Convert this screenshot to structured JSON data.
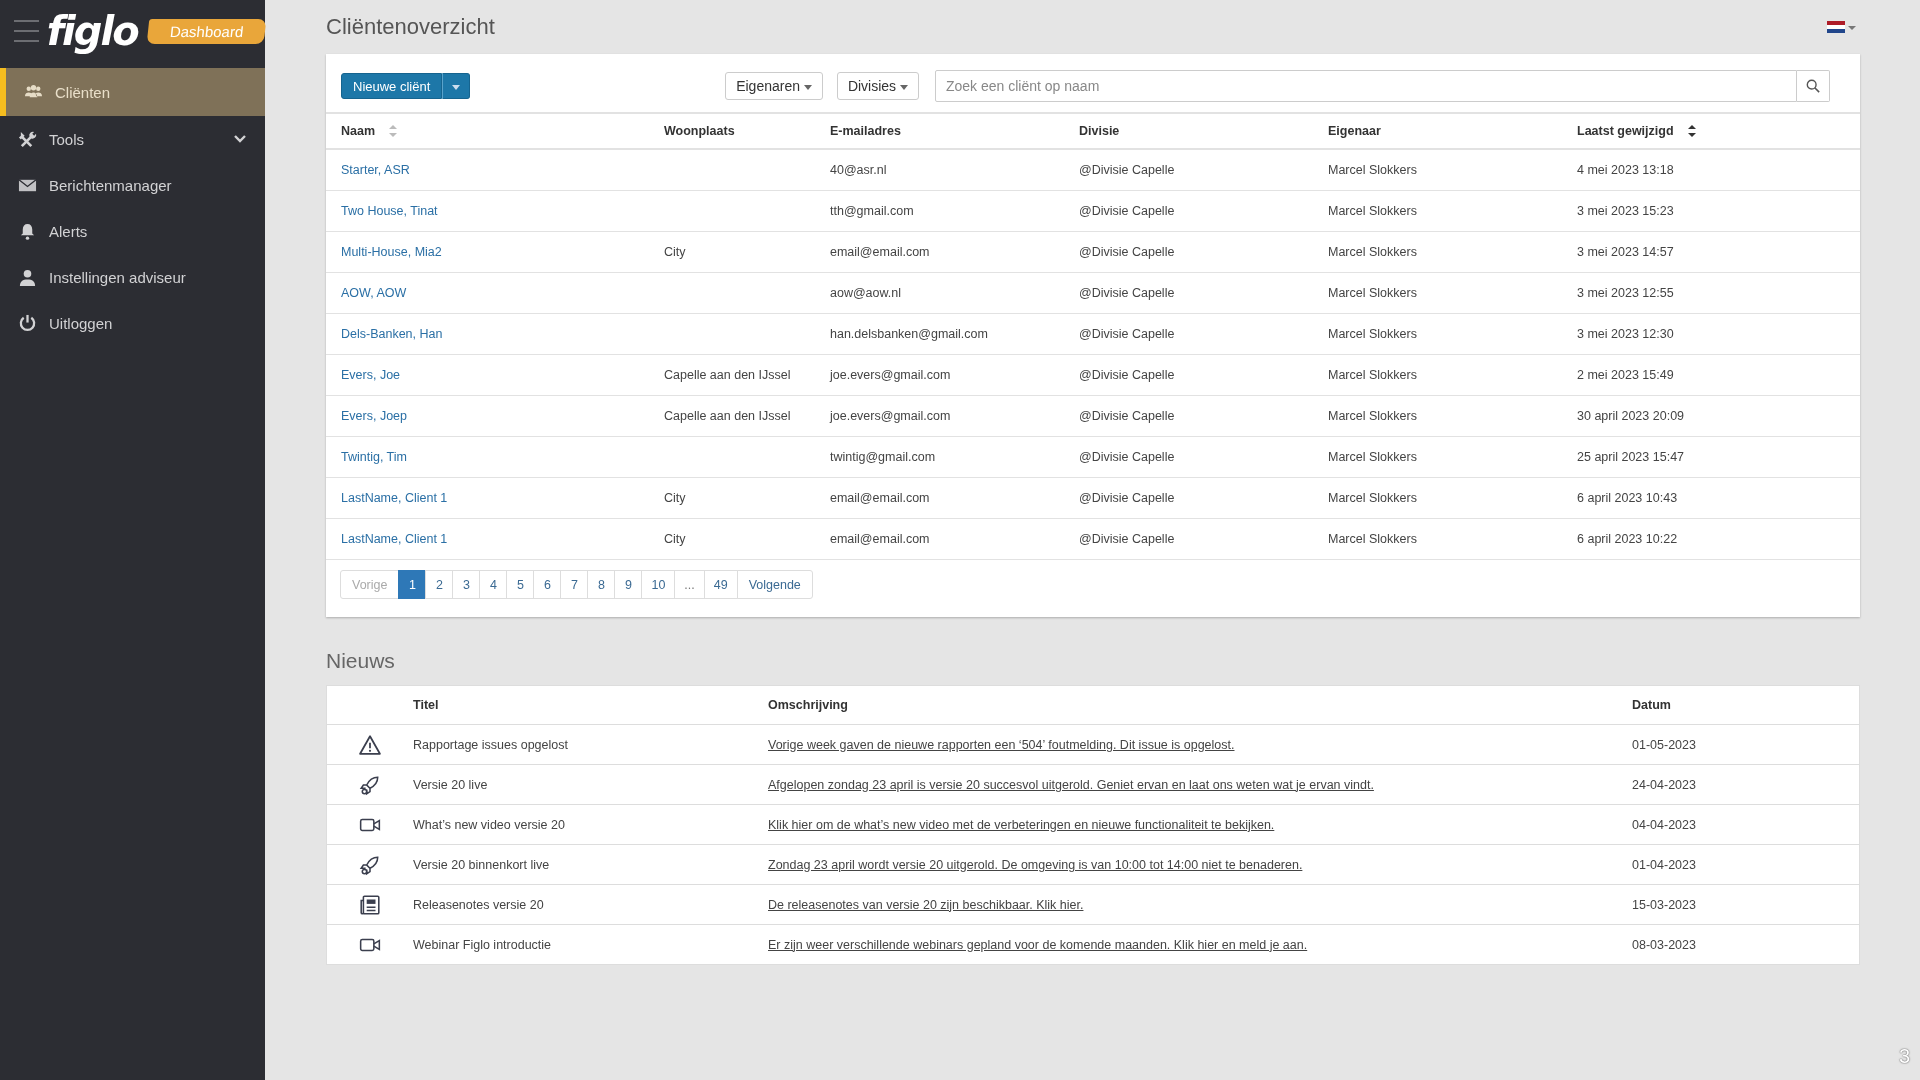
{
  "sidebar": {
    "logo": "figlo",
    "badge": "Dashboard",
    "items": [
      {
        "label": "Cliënten",
        "kind": "users",
        "selected": true
      },
      {
        "label": "Tools",
        "kind": "tools",
        "selected": false,
        "expandable": true
      },
      {
        "label": "Berichtenmanager",
        "kind": "mail",
        "selected": false
      },
      {
        "label": "Alerts",
        "kind": "bell",
        "selected": false
      },
      {
        "label": "Instellingen adviseur",
        "kind": "user",
        "selected": false
      },
      {
        "label": "Uitloggen",
        "kind": "power",
        "selected": false
      }
    ]
  },
  "page_title": "Cliëntenoverzicht",
  "toolbar": {
    "new_button": "Nieuwe cliënt",
    "filters": [
      "Eigenaren",
      "Divisies"
    ],
    "search": {
      "placeholder": "Zoek een cliënt op naam"
    }
  },
  "clients": {
    "columns": [
      {
        "label": "Naam",
        "sortable": true,
        "sorted": false
      },
      {
        "label": "Woonplaats"
      },
      {
        "label": "E-mailadres"
      },
      {
        "label": "Divisie"
      },
      {
        "label": "Eigenaar"
      },
      {
        "label": "Laatst gewijzigd",
        "sortable": true,
        "sorted": true
      }
    ],
    "rows": [
      [
        "Starter, ASR",
        "",
        "40@asr.nl",
        "@Divisie Capelle",
        "Marcel Slokkers",
        "4 mei 2023 13:18"
      ],
      [
        "Two House, Tinat",
        "",
        "tth@gmail.com",
        "@Divisie Capelle",
        "Marcel Slokkers",
        "3 mei 2023 15:23"
      ],
      [
        "Multi-House, Mia2",
        "City",
        "email@email.com",
        "@Divisie Capelle",
        "Marcel Slokkers",
        "3 mei 2023 14:57"
      ],
      [
        "AOW, AOW",
        "",
        "aow@aow.nl",
        "@Divisie Capelle",
        "Marcel Slokkers",
        "3 mei 2023 12:55"
      ],
      [
        "Dels-Banken, Han",
        "",
        "han.delsbanken@gmail.com",
        "@Divisie Capelle",
        "Marcel Slokkers",
        "3 mei 2023 12:30"
      ],
      [
        "Evers, Joe",
        "Capelle aan den IJssel",
        "joe.evers@gmail.com",
        "@Divisie Capelle",
        "Marcel Slokkers",
        "2 mei 2023 15:49"
      ],
      [
        "Evers, Joep",
        "Capelle aan den IJssel",
        "joe.evers@gmail.com",
        "@Divisie Capelle",
        "Marcel Slokkers",
        "30 april 2023 20:09"
      ],
      [
        "Twintig, Tim",
        "",
        "twintig@gmail.com",
        "@Divisie Capelle",
        "Marcel Slokkers",
        "25 april 2023 15:47"
      ],
      [
        "LastName, Client 1",
        "City",
        "email@email.com",
        "@Divisie Capelle",
        "Marcel Slokkers",
        "6 april 2023 10:43"
      ],
      [
        "LastName, Client 1",
        "City",
        "email@email.com",
        "@Divisie Capelle",
        "Marcel Slokkers",
        "6 april 2023 10:22"
      ]
    ],
    "pagination": [
      {
        "label": "Vorige",
        "kind": "prev",
        "disabled": true,
        "selected": false
      },
      {
        "label": "1",
        "kind": "page",
        "selected": true
      },
      {
        "label": "2",
        "kind": "page",
        "selected": false
      },
      {
        "label": "3",
        "kind": "page",
        "selected": false
      },
      {
        "label": "4",
        "kind": "page",
        "selected": false
      },
      {
        "label": "5",
        "kind": "page",
        "selected": false
      },
      {
        "label": "6",
        "kind": "page",
        "selected": false
      },
      {
        "label": "7",
        "kind": "page",
        "selected": false
      },
      {
        "label": "8",
        "kind": "page",
        "selected": false
      },
      {
        "label": "9",
        "kind": "page",
        "selected": false
      },
      {
        "label": "10",
        "kind": "page",
        "selected": false
      },
      {
        "label": "...",
        "kind": "gap",
        "selected": false
      },
      {
        "label": "49",
        "kind": "page",
        "selected": false
      },
      {
        "label": "Volgende",
        "kind": "next",
        "disabled": false,
        "selected": false
      }
    ]
  },
  "news": {
    "title": "Nieuws",
    "columns": [
      "Titel",
      "Omschrijving",
      "Datum"
    ],
    "rows": [
      {
        "kind": "warning",
        "title": "Rapportage issues opgelost",
        "description": "Vorige week gaven de nieuwe rapporten een ‘504’ foutmelding. Dit issue is opgelost.",
        "date": "01-05-2023"
      },
      {
        "kind": "rocket",
        "title": "Versie 20 live",
        "description": "Afgelopen zondag 23 april is versie 20 succesvol uitgerold. Geniet ervan en laat ons weten wat je ervan vindt.",
        "date": "24-04-2023"
      },
      {
        "kind": "video",
        "title": "What’s new video versie 20",
        "description": "Klik hier om de what’s new video met de verbeteringen en nieuwe functionaliteit te bekijken.",
        "date": "04-04-2023"
      },
      {
        "kind": "rocket",
        "title": "Versie 20 binnenkort live",
        "description": "Zondag 23 april wordt versie 20 uitgerold. De omgeving is van 10:00 tot 14:00 niet te benaderen.",
        "date": "01-04-2023"
      },
      {
        "kind": "newspaper",
        "title": "Releasenotes versie 20",
        "description": "De releasenotes van versie 20 zijn beschikbaar. Klik hier.",
        "date": "15-03-2023"
      },
      {
        "kind": "video",
        "title": "Webinar Figlo introductie",
        "description": "Er zijn weer verschillende webinars gepland voor de komende maanden. Klik hier en meld je aan.",
        "date": "08-03-2023"
      }
    ]
  },
  "corner_label": "3"
}
